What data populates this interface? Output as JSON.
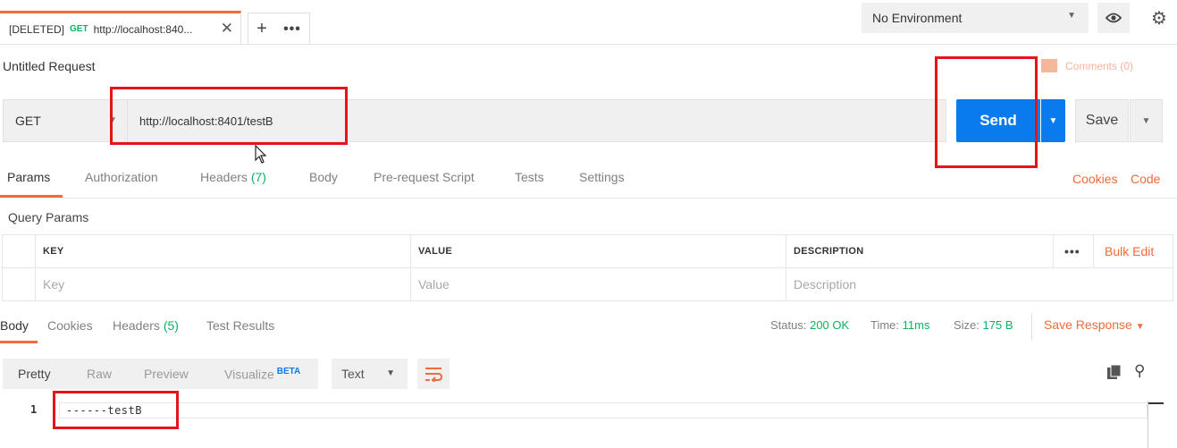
{
  "tabs": {
    "active": {
      "prefix": "[DELETED]",
      "method": "GET",
      "label": "http://localhost:840...",
      "close": "✕"
    },
    "new_tab": "+",
    "more": "•••"
  },
  "environment": {
    "selected": "No Environment"
  },
  "request": {
    "title": "Untitled Request",
    "comments_label": "Comments (0)",
    "method": "GET",
    "url": "http://localhost:8401/testB",
    "send_label": "Send",
    "save_label": "Save"
  },
  "request_tabs": {
    "items": [
      "Params",
      "Authorization",
      "Headers",
      "Body",
      "Pre-request Script",
      "Tests",
      "Settings"
    ],
    "headers_count": "(7)",
    "cookies_link": "Cookies",
    "code_link": "Code"
  },
  "query_params": {
    "title": "Query Params",
    "columns": [
      "KEY",
      "VALUE",
      "DESCRIPTION"
    ],
    "placeholders": [
      "Key",
      "Value",
      "Description"
    ],
    "more": "•••",
    "bulk_edit": "Bulk Edit"
  },
  "response": {
    "tabs": [
      "Body",
      "Cookies",
      "Headers",
      "Test Results"
    ],
    "headers_count": "(5)",
    "status_label": "Status:",
    "status_value": "200 OK",
    "time_label": "Time:",
    "time_value": "11ms",
    "size_label": "Size:",
    "size_value": "175 B",
    "save_response": "Save Response",
    "format_tabs": [
      "Pretty",
      "Raw",
      "Preview",
      "Visualize"
    ],
    "beta": "BETA",
    "format_select": "Text",
    "line_number": "1",
    "body_text": "------testB"
  },
  "colors": {
    "accent": "#f26b3a",
    "send": "#097bed",
    "success": "#0cb25f",
    "annotation": "#e5141a"
  }
}
